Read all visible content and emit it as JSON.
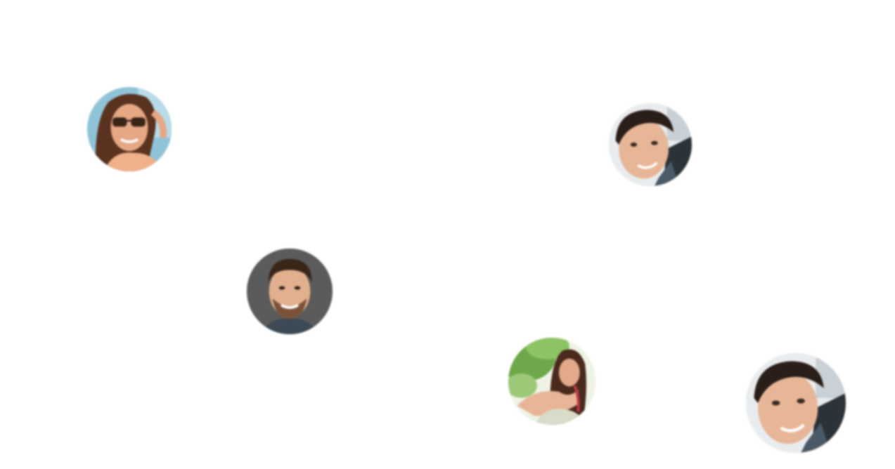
{
  "avatars": [
    {
      "name": "avatar-woman-sunglasses",
      "icon": "person-photo-icon",
      "bg": "#8fc3d8"
    },
    {
      "name": "avatar-man-dark-hair",
      "icon": "person-photo-icon",
      "bg": "#e9ecee"
    },
    {
      "name": "avatar-man-smiling",
      "icon": "person-photo-icon",
      "bg": "#5b5b5b"
    },
    {
      "name": "avatar-woman-green-background",
      "icon": "person-photo-icon",
      "bg": "#7fb35a"
    },
    {
      "name": "avatar-man-dark-hair-large",
      "icon": "person-photo-icon",
      "bg": "#e9ecee"
    }
  ]
}
